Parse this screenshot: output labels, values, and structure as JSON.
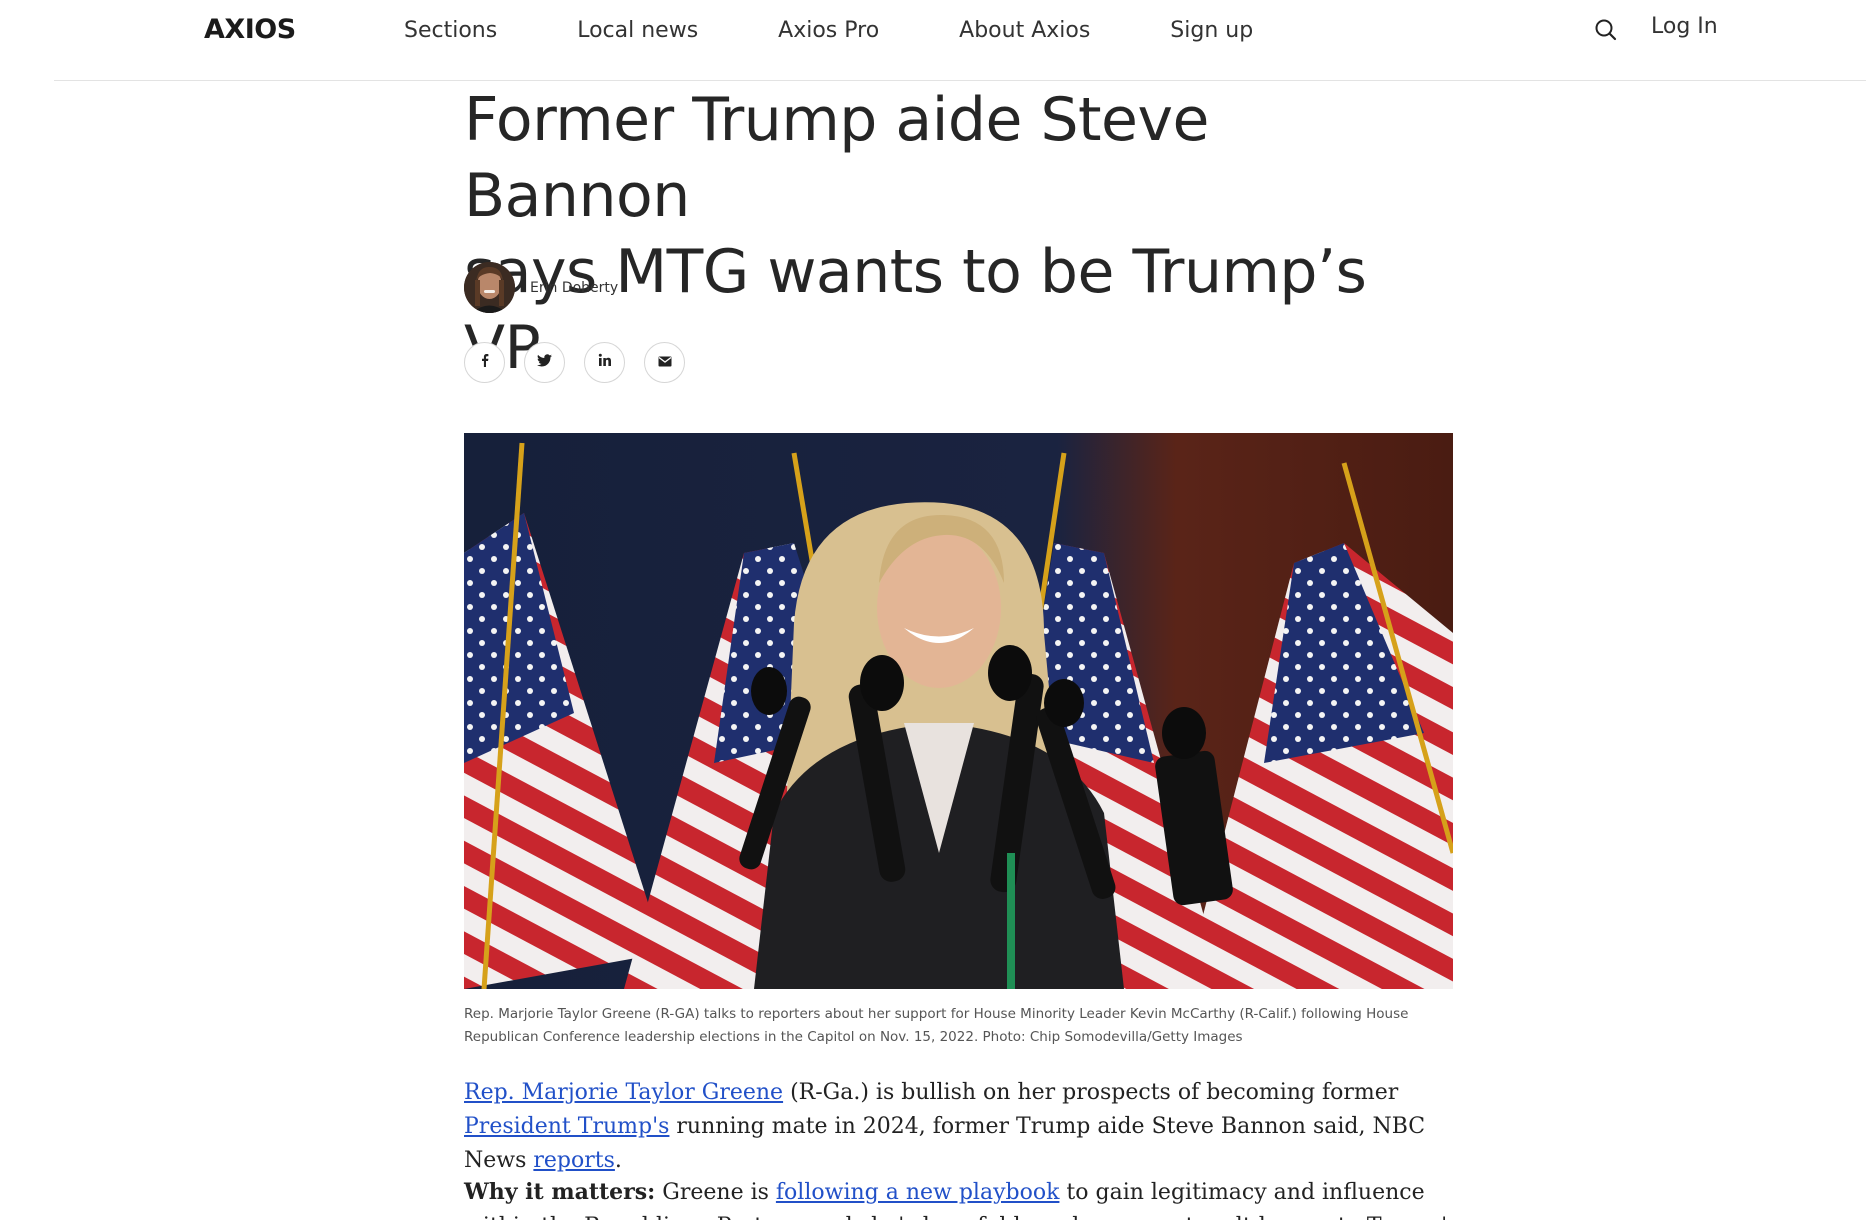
{
  "header": {
    "logo": "AXIOS",
    "nav": [
      "Sections",
      "Local news",
      "Axios Pro",
      "About Axios",
      "Sign up"
    ],
    "login": "Log In"
  },
  "article": {
    "title_line1": "Former Trump aide Steve Bannon",
    "title_line2": "says MTG wants to be Trump’s VP",
    "author": "Erin Doherty",
    "share": [
      "facebook-icon",
      "twitter-icon",
      "linkedin-icon",
      "email-icon"
    ],
    "caption_line1": "Rep. Marjorie Taylor Greene (R-GA) talks to reporters about her support for House Minority Leader Kevin McCarthy (R-Calif.) following House",
    "caption_line2": "Republican Conference leadership elections in the Capitol on Nov. 15, 2022. Photo: Chip Somodevilla/Getty Images",
    "p1": {
      "link1": "Rep. Marjorie Taylor Greene",
      "t1": " (R-Ga.) is bullish on her prospects of becoming former ",
      "link2": "President Trump's",
      "t2": " running mate in 2024, former Trump aide Steve Bannon said, NBC News ",
      "link3": "reports",
      "t3": "."
    },
    "p2": {
      "lead": "Why it matters:",
      "t1": " Greene is ",
      "link1": "following a new playbook",
      "t2": " to gain legitimacy and influence within the Republican Party — and she's hopeful her plan can catapult her on to Trump's ticket and into the"
    }
  },
  "colors": {
    "link": "#2150c8",
    "logo_accent": "#2c5bd6",
    "text": "#222222"
  }
}
